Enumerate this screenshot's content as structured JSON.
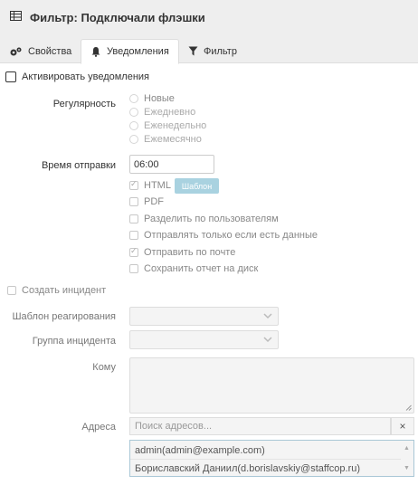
{
  "header": {
    "title": "Фильтр: Подключали флэшки",
    "icon": "table-icon"
  },
  "tabs": [
    {
      "label": "Свойства",
      "icon": "gears-icon"
    },
    {
      "label": "Уведомления",
      "icon": "bell-icon",
      "active": true
    },
    {
      "label": "Фильтр",
      "icon": "funnel-icon"
    }
  ],
  "notifications": {
    "activate_label": "Активировать уведомления",
    "activate_checked": false,
    "regularity_label": "Регулярность",
    "regularity_options": [
      "Новые",
      "Ежедневно",
      "Еженедельно",
      "Ежемесячно"
    ],
    "send_time_label": "Время отправки",
    "send_time_value": "06:00",
    "html_label": "HTML",
    "template_button": "Шаблон",
    "pdf_label": "PDF",
    "split_by_users_label": "Разделить по пользователям",
    "send_only_if_data_label": "Отправлять только если есть данные",
    "send_by_mail_label": "Отправить по почте",
    "save_to_disk_label": "Сохранить отчет на диск"
  },
  "incident": {
    "create_label": "Создать инцидент",
    "response_template_label": "Шаблон реагирования",
    "incident_group_label": "Группа инцидента",
    "to_label": "Кому",
    "addresses_label": "Адреса",
    "address_search_placeholder": "Поиск адресов...",
    "clear_label": "×",
    "address_list": [
      "admin(admin@example.com)",
      "Бориславский Даниил(d.borislavskiy@staffcop.ru)"
    ]
  }
}
